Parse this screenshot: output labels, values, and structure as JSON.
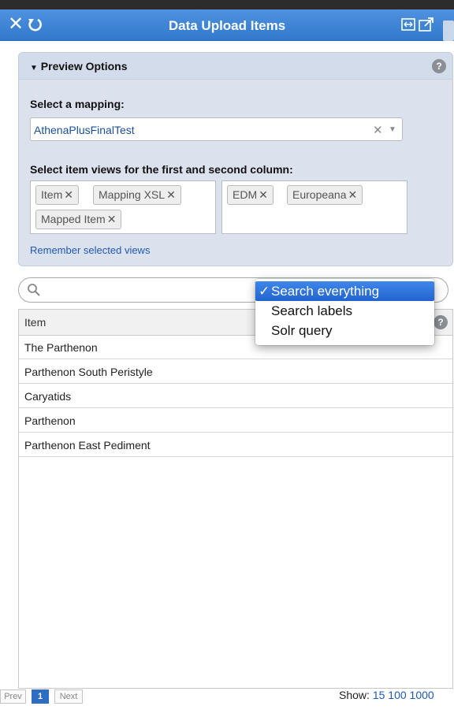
{
  "window": {
    "title": "Data Upload Items",
    "icons": [
      "close-icon",
      "refresh-icon",
      "expand-icon",
      "popout-icon"
    ]
  },
  "preview": {
    "title": "Preview Options",
    "help": "?",
    "mapping_label": "Select a mapping:",
    "mapping_value": "AthenaPlusFinalTest",
    "views_label": "Select item views for the first and second column:",
    "column1_views": [
      "Item",
      "Mapping XSL",
      "Mapped Item"
    ],
    "column2_views": [
      "EDM",
      "Europeana"
    ],
    "remember_link": "Remember selected views"
  },
  "search": {
    "menu": [
      {
        "label": "Search everything",
        "selected": true,
        "check": "✓"
      },
      {
        "label": "Search labels",
        "selected": false,
        "check": ""
      },
      {
        "label": "Solr query",
        "selected": false,
        "check": ""
      }
    ]
  },
  "table": {
    "header": "Item",
    "help": "?",
    "rows": [
      "The Parthenon",
      "Parthenon South Peristyle",
      "Caryatids",
      "Parthenon",
      "Parthenon East Pediment"
    ]
  },
  "pager": {
    "prev": "Prev",
    "page": "1",
    "next": "Next",
    "show_label": "Show:",
    "sizes": [
      "15",
      "100",
      "1000"
    ]
  },
  "colors": {
    "titlebar": "#3f86d9",
    "panel": "#dbe2ee",
    "link": "#1f58b7",
    "menu_highlight": "#2f6fd8"
  }
}
